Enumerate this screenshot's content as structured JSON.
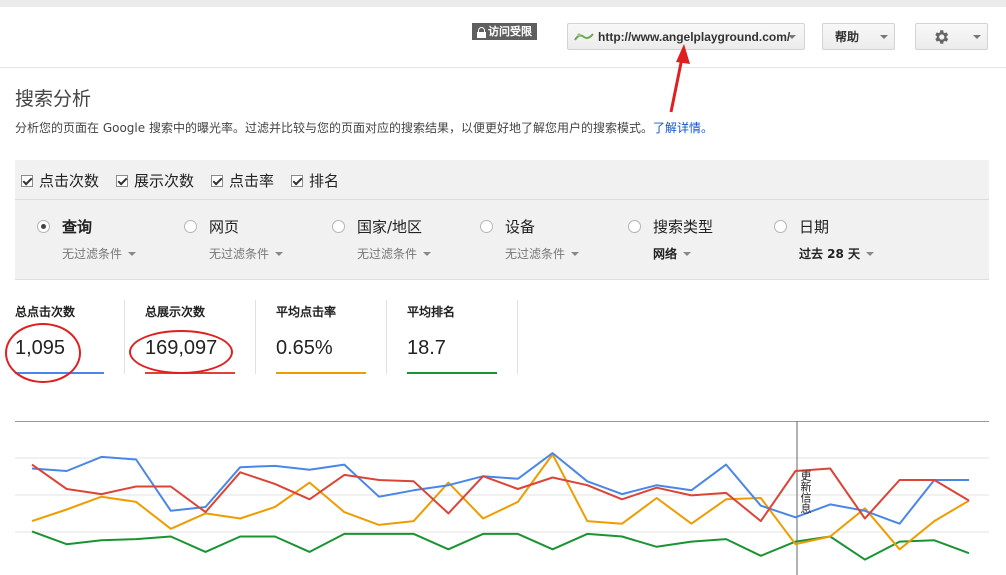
{
  "header": {
    "access_badge": "访问受限",
    "site_url": "http://www.angelplayground.com/",
    "help_label": "帮助"
  },
  "page": {
    "title": "搜索分析",
    "description": "分析您的页面在 Google 搜索中的曝光率。过滤并比较与您的页面对应的搜索结果，以便更好地了解您用户的搜索模式。",
    "learn_more": "了解详情。"
  },
  "metrics": [
    {
      "label": "点击次数",
      "checked": true
    },
    {
      "label": "展示次数",
      "checked": true
    },
    {
      "label": "点击率",
      "checked": true
    },
    {
      "label": "排名",
      "checked": true
    }
  ],
  "dimensions": [
    {
      "label": "查询",
      "filter": "无过滤条件",
      "selected": true
    },
    {
      "label": "网页",
      "filter": "无过滤条件",
      "selected": false
    },
    {
      "label": "国家/地区",
      "filter": "无过滤条件",
      "selected": false
    },
    {
      "label": "设备",
      "filter": "无过滤条件",
      "selected": false
    },
    {
      "label": "搜索类型",
      "filter": "网络",
      "selected": false
    },
    {
      "label": "日期",
      "filter": "过去 28 天",
      "selected": false
    }
  ],
  "totals": [
    {
      "label": "总点击次数",
      "value": "1,095",
      "color": "#4a86e8"
    },
    {
      "label": "总展示次数",
      "value": "169,097",
      "color": "#db4437"
    },
    {
      "label": "平均点击率",
      "value": "0.65%",
      "color": "#f09c00"
    },
    {
      "label": "平均排名",
      "value": "18.7",
      "color": "#1a9432"
    }
  ],
  "colors": {
    "clicks": "#4a86e8",
    "impressions": "#db4437",
    "ctr": "#f09c00",
    "position": "#1a9432",
    "annotation_red": "#e02020"
  },
  "chart": {
    "update_label": "更新信息"
  },
  "chart_data": {
    "type": "line",
    "grid": true,
    "x_count": 28,
    "series": [
      {
        "key": "clicks",
        "values": [
          63,
          61,
          72,
          70,
          30,
          33,
          64,
          65,
          62,
          66,
          41,
          46,
          50,
          57,
          55,
          75,
          53,
          43,
          50,
          46,
          66,
          34,
          25,
          35,
          30,
          20,
          54,
          54
        ]
      },
      {
        "key": "impressions",
        "values": [
          66,
          47,
          43,
          49,
          49,
          29,
          60,
          51,
          39,
          58,
          54,
          53,
          28,
          57,
          47,
          56,
          50,
          39,
          48,
          42,
          44,
          22,
          61,
          63,
          24,
          54,
          54,
          38
        ]
      },
      {
        "key": "ctr",
        "values": [
          22,
          31,
          41,
          37,
          16,
          28,
          24,
          33,
          52,
          29,
          19,
          22,
          52,
          24,
          37,
          74,
          22,
          20,
          40,
          20,
          39,
          40,
          4,
          10,
          32,
          0,
          22,
          38
        ]
      },
      {
        "key": "position",
        "values": [
          14,
          4,
          7,
          8,
          10,
          -2,
          10,
          10,
          -2,
          12,
          12,
          12,
          0,
          12,
          12,
          0,
          12,
          10,
          2,
          6,
          8,
          -5,
          6,
          10,
          -8,
          6,
          7,
          -3
        ]
      }
    ]
  }
}
